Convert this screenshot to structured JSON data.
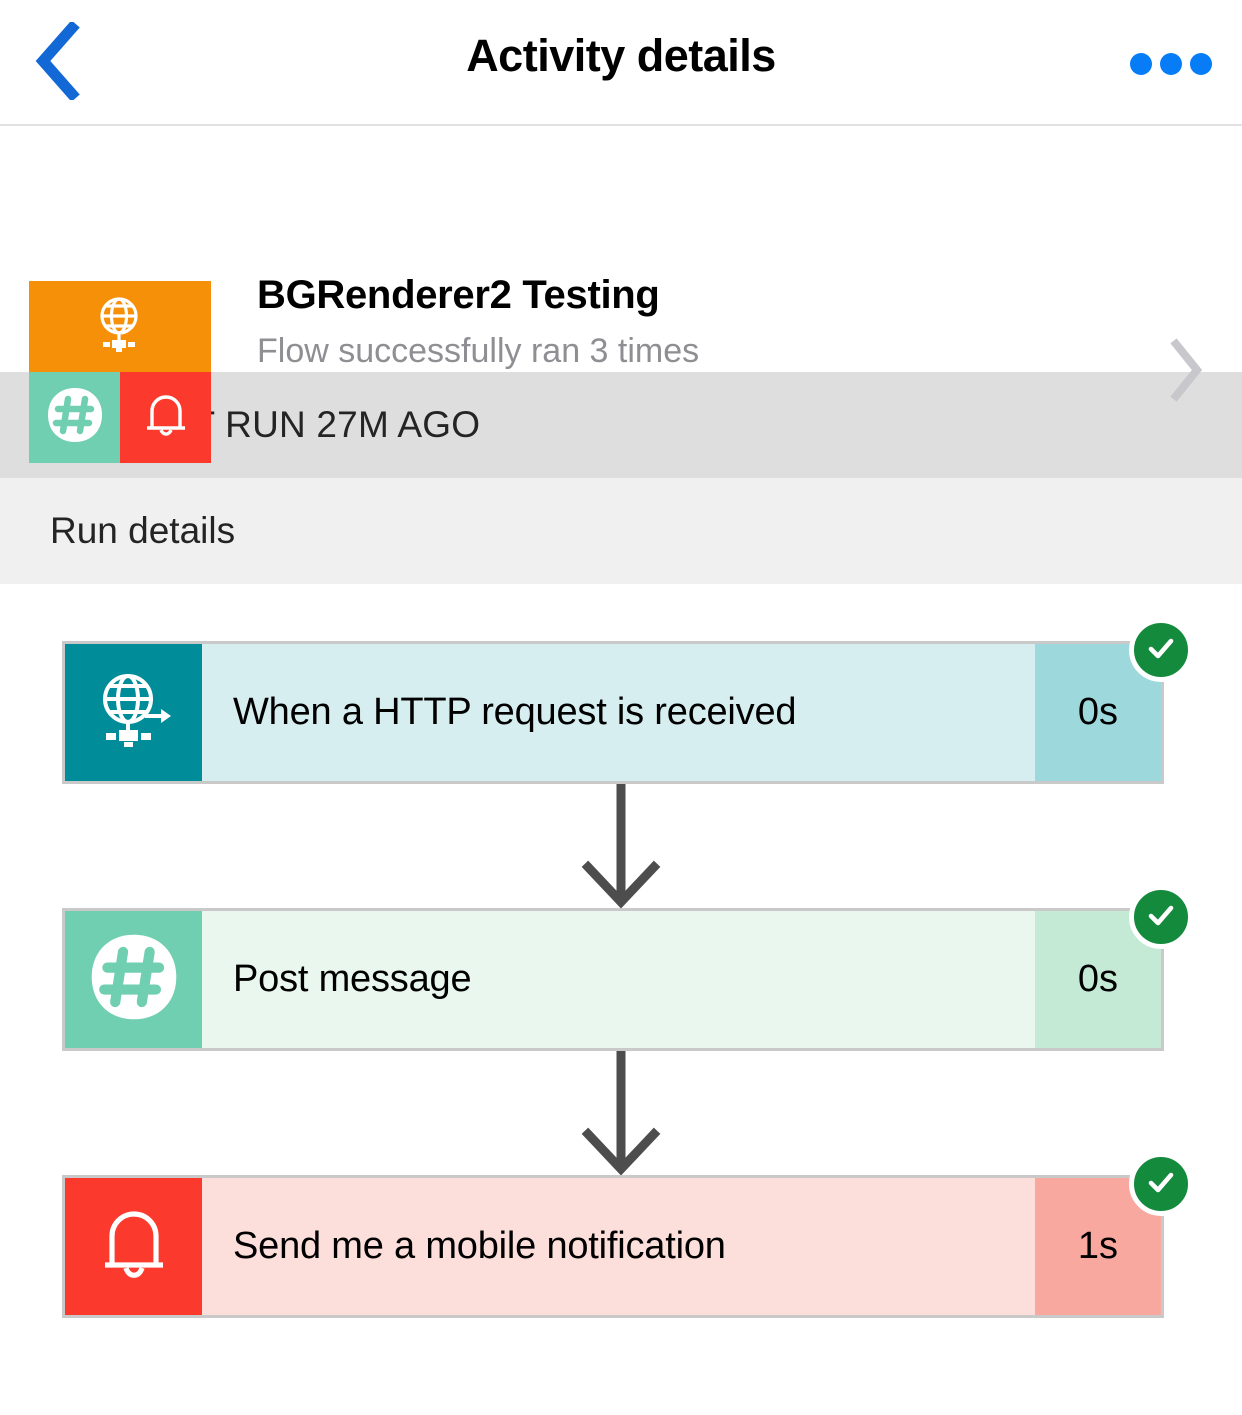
{
  "navbar": {
    "back_icon": "chevron-left-icon",
    "title": "Activity details",
    "more_icon": "more-horizontal-icon",
    "accent_color": "#067df7",
    "back_color": "#1268d4"
  },
  "flow": {
    "title": "BGRenderer2 Testing",
    "subtitle": "Flow successfully ran 3 times",
    "chevron_icon": "chevron-right-icon",
    "tile": {
      "top_icon": "globe-http-icon",
      "top_color": "#f79009",
      "bottom_left_icon": "slack-hash-icon",
      "bottom_left_color": "#6fcfb0",
      "bottom_right_icon": "bell-icon",
      "bottom_right_color": "#fb3a2d"
    }
  },
  "sections": {
    "last_run": {
      "icon": "history-clock-icon",
      "label": "LAST RUN 27M AGO",
      "background": "#dedede"
    },
    "run_details": {
      "label": "Run details",
      "background": "#f0f0f0"
    }
  },
  "steps": [
    {
      "name": "When a HTTP request is received",
      "duration": "0s",
      "status": "succeeded",
      "status_icon": "check-circle-icon",
      "icon": "globe-http-icon",
      "icon_color": "#008d99",
      "body_color": "#d6eef0",
      "duration_color": "#9cd8dc"
    },
    {
      "name": "Post message",
      "duration": "0s",
      "status": "succeeded",
      "status_icon": "check-circle-icon",
      "icon": "slack-hash-icon",
      "icon_color": "#6fcfb0",
      "body_color": "#e9f7ef",
      "duration_color": "#c4ead6"
    },
    {
      "name": "Send me a mobile notification",
      "duration": "1s",
      "status": "succeeded",
      "status_icon": "check-circle-icon",
      "icon": "bell-icon",
      "icon_color": "#fb3a2d",
      "body_color": "#fcdedb",
      "duration_color": "#f9a8a0"
    }
  ],
  "connector": {
    "icon": "arrow-down-icon",
    "color": "#4d4d4d"
  },
  "status_color": "#148a3d"
}
